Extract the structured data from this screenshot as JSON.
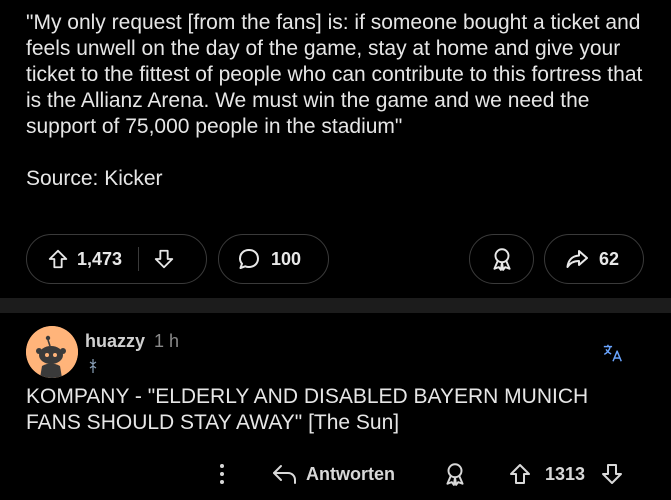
{
  "post": {
    "quote": "\"My only request [from the fans] is: if someone bought a ticket and feels unwell on the day of the game, stay at home and give your ticket to the fittest of people who can contribute to this fortress that is the Allianz Arena. We must win the game and we need the support of 75,000 people in the stadium\"",
    "source": "Source: Kicker"
  },
  "actions": {
    "upvotes": "1,473",
    "comments": "100",
    "shares": "62"
  },
  "comment": {
    "username": "huazzy",
    "time": "1 h",
    "text": "KOMPANY - \"ELDERLY AND DISABLED BAYERN MUNICH FANS SHOULD STAY AWAY\" [The Sun]",
    "reply_label": "Antworten",
    "score": "1313"
  },
  "icons": {
    "upvote": "arrow-up-icon",
    "downvote": "arrow-down-icon",
    "comment": "speech-bubble-icon",
    "award": "award-icon",
    "share": "share-arrow-icon",
    "translate": "translate-icon",
    "more": "vertical-dots-icon",
    "reply": "reply-arrow-icon"
  },
  "colors": {
    "background": "#000000",
    "avatar": "#ffb47a",
    "translate": "#6aa5ff",
    "divider": "#1c1c1c"
  }
}
